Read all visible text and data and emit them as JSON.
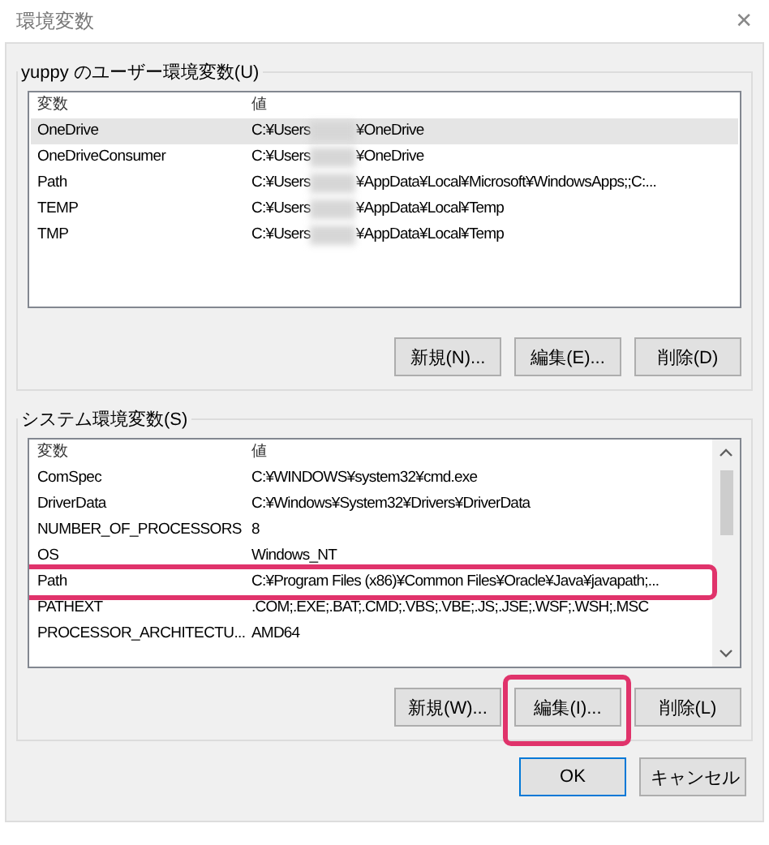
{
  "window": {
    "title": "環境変数",
    "close": "✕"
  },
  "user_variables": {
    "label": "yuppy のユーザー環境変数(U)",
    "columns": [
      "変数",
      "値"
    ],
    "rows": [
      {
        "name": "OneDrive",
        "value_start": "C:¥Users",
        "redacted": true,
        "value_end": "¥OneDrive",
        "selected": true,
        "highlighted": false
      },
      {
        "name": "OneDriveConsumer",
        "value_start": "C:¥Users",
        "redacted": true,
        "value_end": "¥OneDrive",
        "selected": false,
        "highlighted": false
      },
      {
        "name": "Path",
        "value_start": "C:¥Users",
        "redacted": true,
        "value_end": "¥AppData¥Local¥Microsoft¥WindowsApps;;C:...",
        "selected": false,
        "highlighted": false
      },
      {
        "name": "TEMP",
        "value_start": "C:¥Users",
        "redacted": true,
        "value_end": "¥AppData¥Local¥Temp",
        "selected": false,
        "highlighted": false
      },
      {
        "name": "TMP",
        "value_start": "C:¥Users",
        "redacted": true,
        "value_end": "¥AppData¥Local¥Temp",
        "selected": false,
        "highlighted": false
      }
    ],
    "scrollbar": false,
    "buttons": [
      {
        "label": "新規(N)...",
        "highlighted": false
      },
      {
        "label": "編集(E)...",
        "highlighted": false
      },
      {
        "label": "削除(D)",
        "highlighted": false
      }
    ]
  },
  "system_variables": {
    "label": "システム環境変数(S)",
    "columns": [
      "変数",
      "値"
    ],
    "rows": [
      {
        "name": "ComSpec",
        "value_start": "C:¥WINDOWS¥system32¥cmd.exe",
        "redacted": false,
        "selected": false,
        "highlighted": false
      },
      {
        "name": "DriverData",
        "value_start": "C:¥Windows¥System32¥Drivers¥DriverData",
        "redacted": false,
        "selected": false,
        "highlighted": false
      },
      {
        "name": "NUMBER_OF_PROCESSORS",
        "value_start": "8",
        "redacted": false,
        "selected": false,
        "highlighted": false
      },
      {
        "name": "OS",
        "value_start": "Windows_NT",
        "redacted": false,
        "selected": false,
        "highlighted": false
      },
      {
        "name": "Path",
        "value_start": "C:¥Program Files (x86)¥Common Files¥Oracle¥Java¥javapath;...",
        "redacted": false,
        "selected": false,
        "highlighted": true
      },
      {
        "name": "PATHEXT",
        "value_start": ".COM;.EXE;.BAT;.CMD;.VBS;.VBE;.JS;.JSE;.WSF;.WSH;.MSC",
        "redacted": false,
        "selected": false,
        "highlighted": false
      },
      {
        "name": "PROCESSOR_ARCHITECTU...",
        "value_start": "AMD64",
        "redacted": false,
        "selected": false,
        "highlighted": false
      }
    ],
    "scrollbar": true,
    "buttons": [
      {
        "label": "新規(W)...",
        "highlighted": false
      },
      {
        "label": "編集(I)...",
        "highlighted": true
      },
      {
        "label": "削除(L)",
        "highlighted": false
      }
    ]
  },
  "dialog_buttons": [
    {
      "label": "OK",
      "default": true
    },
    {
      "label": "キャンセル",
      "default": false
    }
  ]
}
